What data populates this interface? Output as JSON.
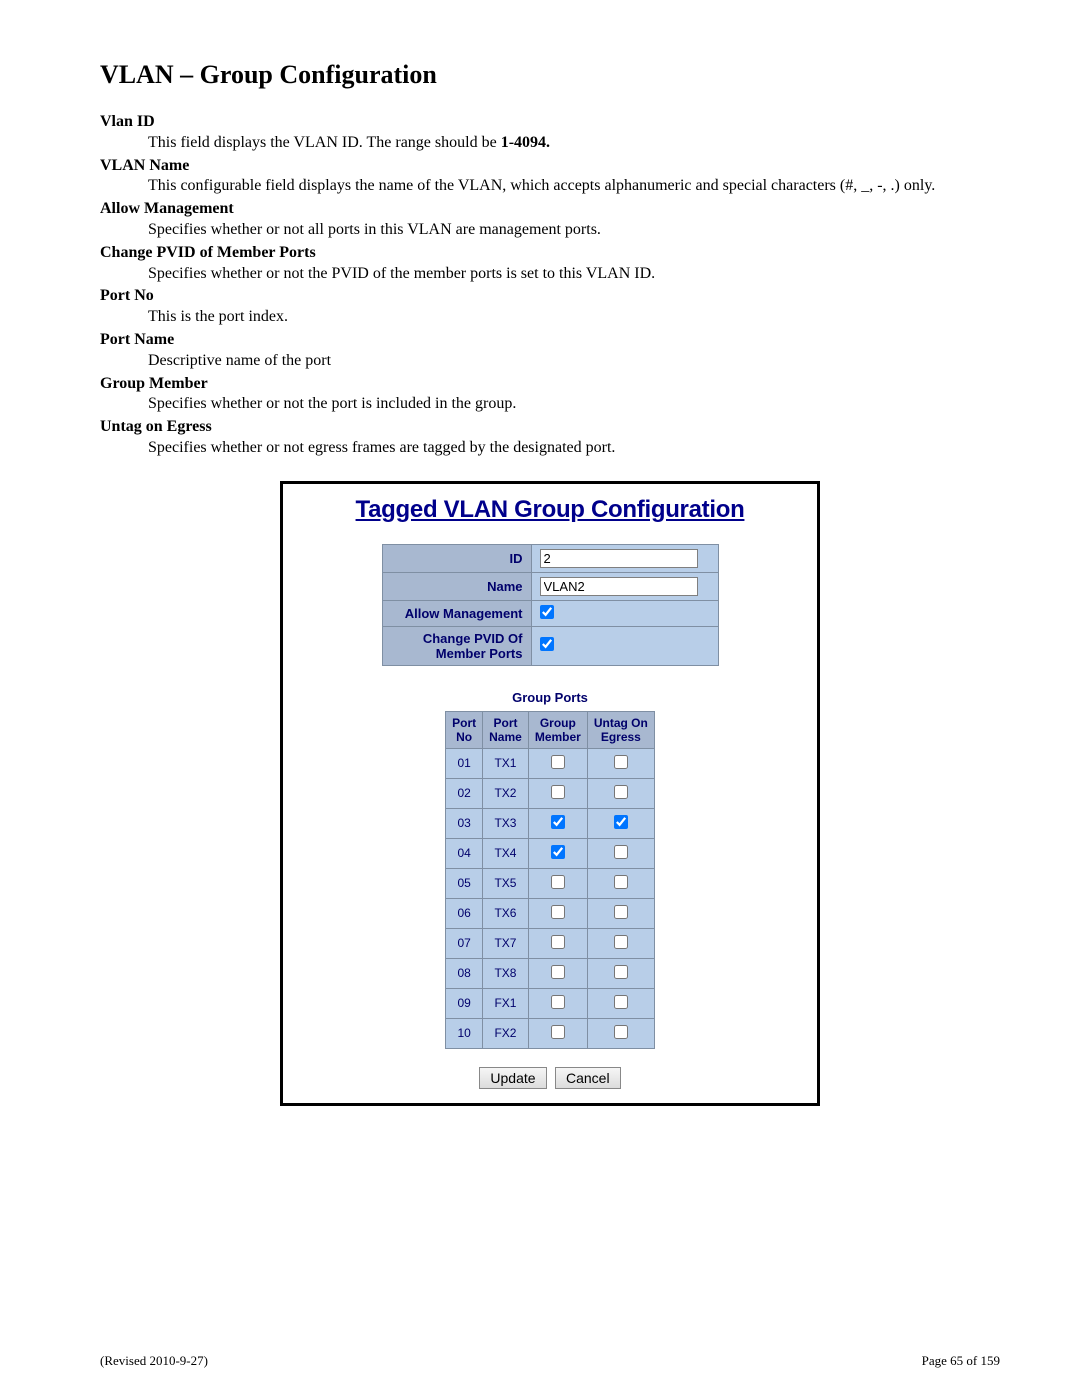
{
  "page_title": "VLAN – Group Configuration",
  "definitions": [
    {
      "term": "Vlan ID",
      "desc_pre": "This field displays the VLAN ID. The range should be ",
      "desc_bold": "1-4094.",
      "desc_post": ""
    },
    {
      "term": "VLAN Name",
      "desc_pre": "This configurable field displays the name of the VLAN, which accepts alphanumeric and special characters (#, _, -, .) only.",
      "desc_bold": "",
      "desc_post": ""
    },
    {
      "term": "Allow Management",
      "desc_pre": "Specifies whether or not all ports in this VLAN are management ports.",
      "desc_bold": "",
      "desc_post": ""
    },
    {
      "term": "Change PVID of Member Ports",
      "desc_pre": "Specifies whether or not the PVID of the member ports is set to this VLAN ID.",
      "desc_bold": "",
      "desc_post": ""
    },
    {
      "term": "Port No",
      "desc_pre": "This is the port index.",
      "desc_bold": "",
      "desc_post": ""
    },
    {
      "term": "Port Name",
      "desc_pre": "Descriptive name of the port",
      "desc_bold": "",
      "desc_post": ""
    },
    {
      "term": "Group Member",
      "desc_pre": "Specifies whether or not the port is included in the group.",
      "desc_bold": "",
      "desc_post": ""
    },
    {
      "term": "Untag on Egress",
      "desc_pre": "Specifies whether or not egress frames are tagged by the designated port.",
      "desc_bold": "",
      "desc_post": ""
    }
  ],
  "ui": {
    "title": "Tagged VLAN Group Configuration",
    "form": {
      "id_label": "ID",
      "id_value": "2",
      "name_label": "Name",
      "name_value": "VLAN2",
      "allow_mgmt_label": "Allow Management",
      "allow_mgmt_checked": true,
      "change_pvid_label_line1": "Change PVID Of",
      "change_pvid_label_line2": "Member Ports",
      "change_pvid_checked": true
    },
    "group_ports_title": "Group Ports",
    "ports_headers": {
      "no": "Port No",
      "name": "Port Name",
      "member": "Group Member",
      "untag": "Untag On Egress"
    },
    "ports": [
      {
        "no": "01",
        "name": "TX1",
        "member": false,
        "untag": false
      },
      {
        "no": "02",
        "name": "TX2",
        "member": false,
        "untag": false
      },
      {
        "no": "03",
        "name": "TX3",
        "member": true,
        "untag": true
      },
      {
        "no": "04",
        "name": "TX4",
        "member": true,
        "untag": false
      },
      {
        "no": "05",
        "name": "TX5",
        "member": false,
        "untag": false
      },
      {
        "no": "06",
        "name": "TX6",
        "member": false,
        "untag": false
      },
      {
        "no": "07",
        "name": "TX7",
        "member": false,
        "untag": false
      },
      {
        "no": "08",
        "name": "TX8",
        "member": false,
        "untag": false
      },
      {
        "no": "09",
        "name": "FX1",
        "member": false,
        "untag": false
      },
      {
        "no": "10",
        "name": "FX2",
        "member": false,
        "untag": false
      }
    ],
    "buttons": {
      "update": "Update",
      "cancel": "Cancel"
    }
  },
  "footer": {
    "revised": "(Revised 2010-9-27)",
    "page": "Page 65 of 159"
  }
}
